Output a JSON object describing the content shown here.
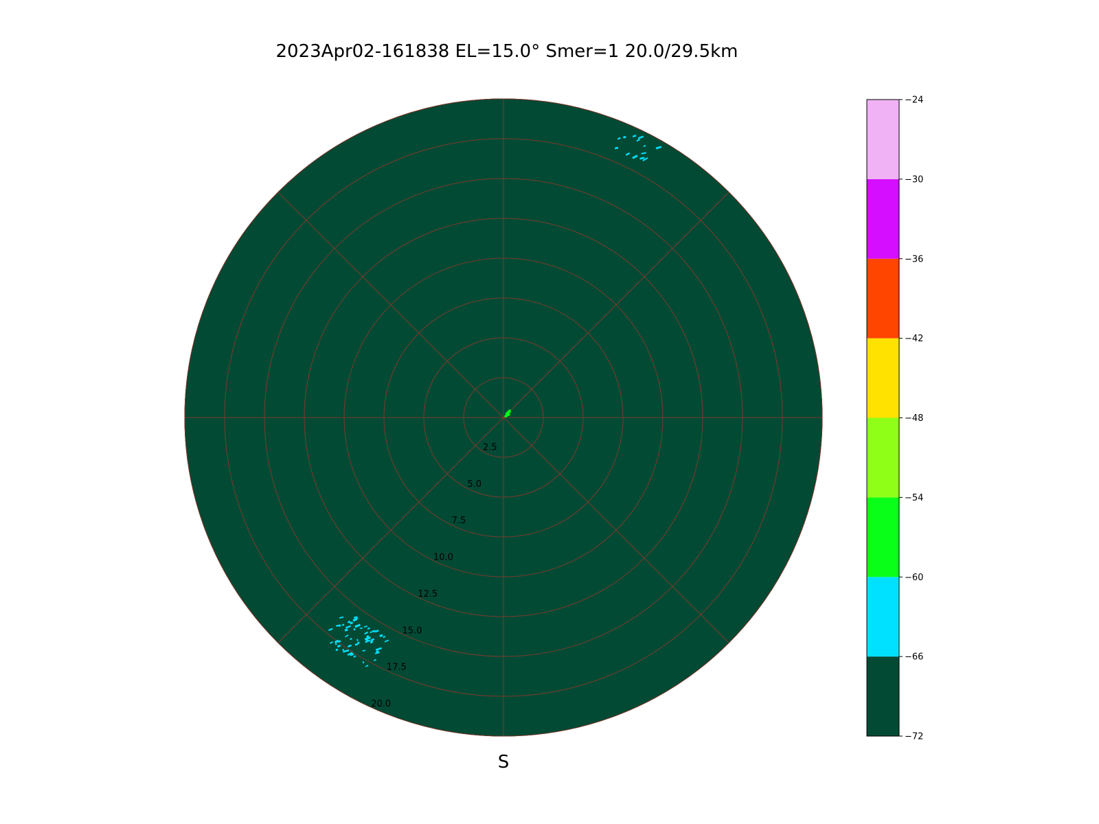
{
  "chart_data": {
    "type": "polar-ppi",
    "title": "2023Apr02-161838  EL=15.0°  Smer=1  20.0/29.5km",
    "direction_label": "S",
    "radial_ticks": [
      "2.5",
      "5.0",
      "7.5",
      "10.0",
      "12.5",
      "15.0",
      "17.5",
      "20.0"
    ],
    "radial_values": [
      2.5,
      5.0,
      7.5,
      10.0,
      12.5,
      15.0,
      17.5,
      20.0
    ],
    "r_max": 20.0,
    "radial_grid_angles_deg": [
      0,
      45,
      90,
      135,
      180,
      225,
      270,
      315
    ],
    "background_color": "#034a35",
    "grid_color": "#7a3b2a",
    "colorbar": {
      "bounds": [
        -72,
        -66,
        -60,
        -54,
        -48,
        -42,
        -36,
        -30,
        -24
      ],
      "tick_labels": [
        "−72",
        "−66",
        "−60",
        "−54",
        "−48",
        "−42",
        "−36",
        "−30",
        "−24"
      ],
      "colors": [
        "#034a35",
        "#00e1ff",
        "#0aff18",
        "#8fff18",
        "#ffe200",
        "#ff4500",
        "#d50eff",
        "#f0b2f4"
      ]
    },
    "echoes": [
      {
        "name": "near-center clutter",
        "color": "#0aff18",
        "range_km": [
          0.0,
          0.6
        ],
        "azimuth_deg": [
          20,
          45
        ],
        "value_dbz": -57
      },
      {
        "name": "northeast patch",
        "color": "#00e1ff",
        "range_km": [
          18.2,
          19.5
        ],
        "azimuth_deg": [
          22,
          30
        ],
        "value_dbz": -63
      },
      {
        "name": "southwest cluster",
        "color": "#00e1ff",
        "range_km": [
          15.5,
          18.0
        ],
        "azimuth_deg": [
          208,
          220
        ],
        "value_dbz": -63
      }
    ]
  }
}
